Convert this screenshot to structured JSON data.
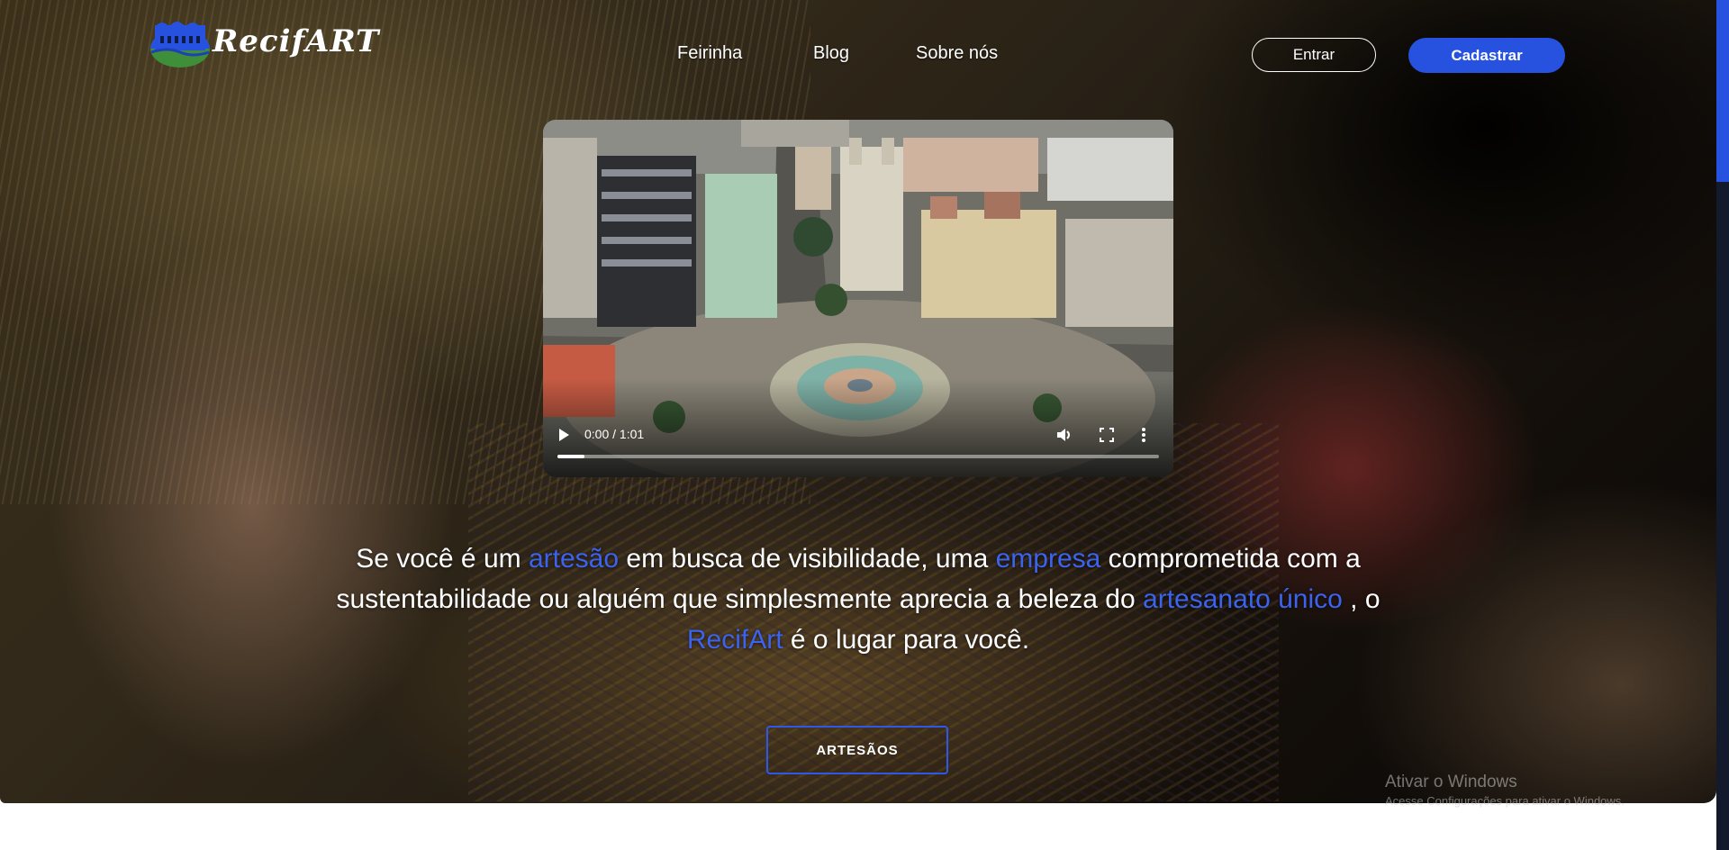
{
  "header": {
    "logo_text": "RecifART",
    "nav": [
      "Feirinha",
      "Blog",
      "Sobre nós"
    ],
    "login_label": "Entrar",
    "signup_label": "Cadastrar"
  },
  "video": {
    "time": "0:00 / 1:01",
    "progress": 0.045,
    "icons": [
      "play-icon",
      "volume-icon",
      "fullscreen-icon",
      "more-options-icon"
    ]
  },
  "tagline": {
    "p1": "Se você é um ",
    "h1": "artesão",
    "p2": " em busca de visibilidade, uma ",
    "h2": "empresa",
    "p3": " comprometida com a sustentabilidade ou alguém que simplesmente aprecia a beleza do ",
    "h3": "artesanato único",
    "p4": " , o ",
    "h4": "RecifArt",
    "p5": " é o lugar para você."
  },
  "cta": {
    "artesaos_label": "ARTESÃOS"
  },
  "windows_watermark": {
    "title": "Ativar o Windows",
    "subtitle": "Acesse Configurações para ativar o Windows."
  },
  "colors": {
    "accent": "#2752e0",
    "highlight": "#3c63ee",
    "scrollbar_track": "#131a2b"
  }
}
